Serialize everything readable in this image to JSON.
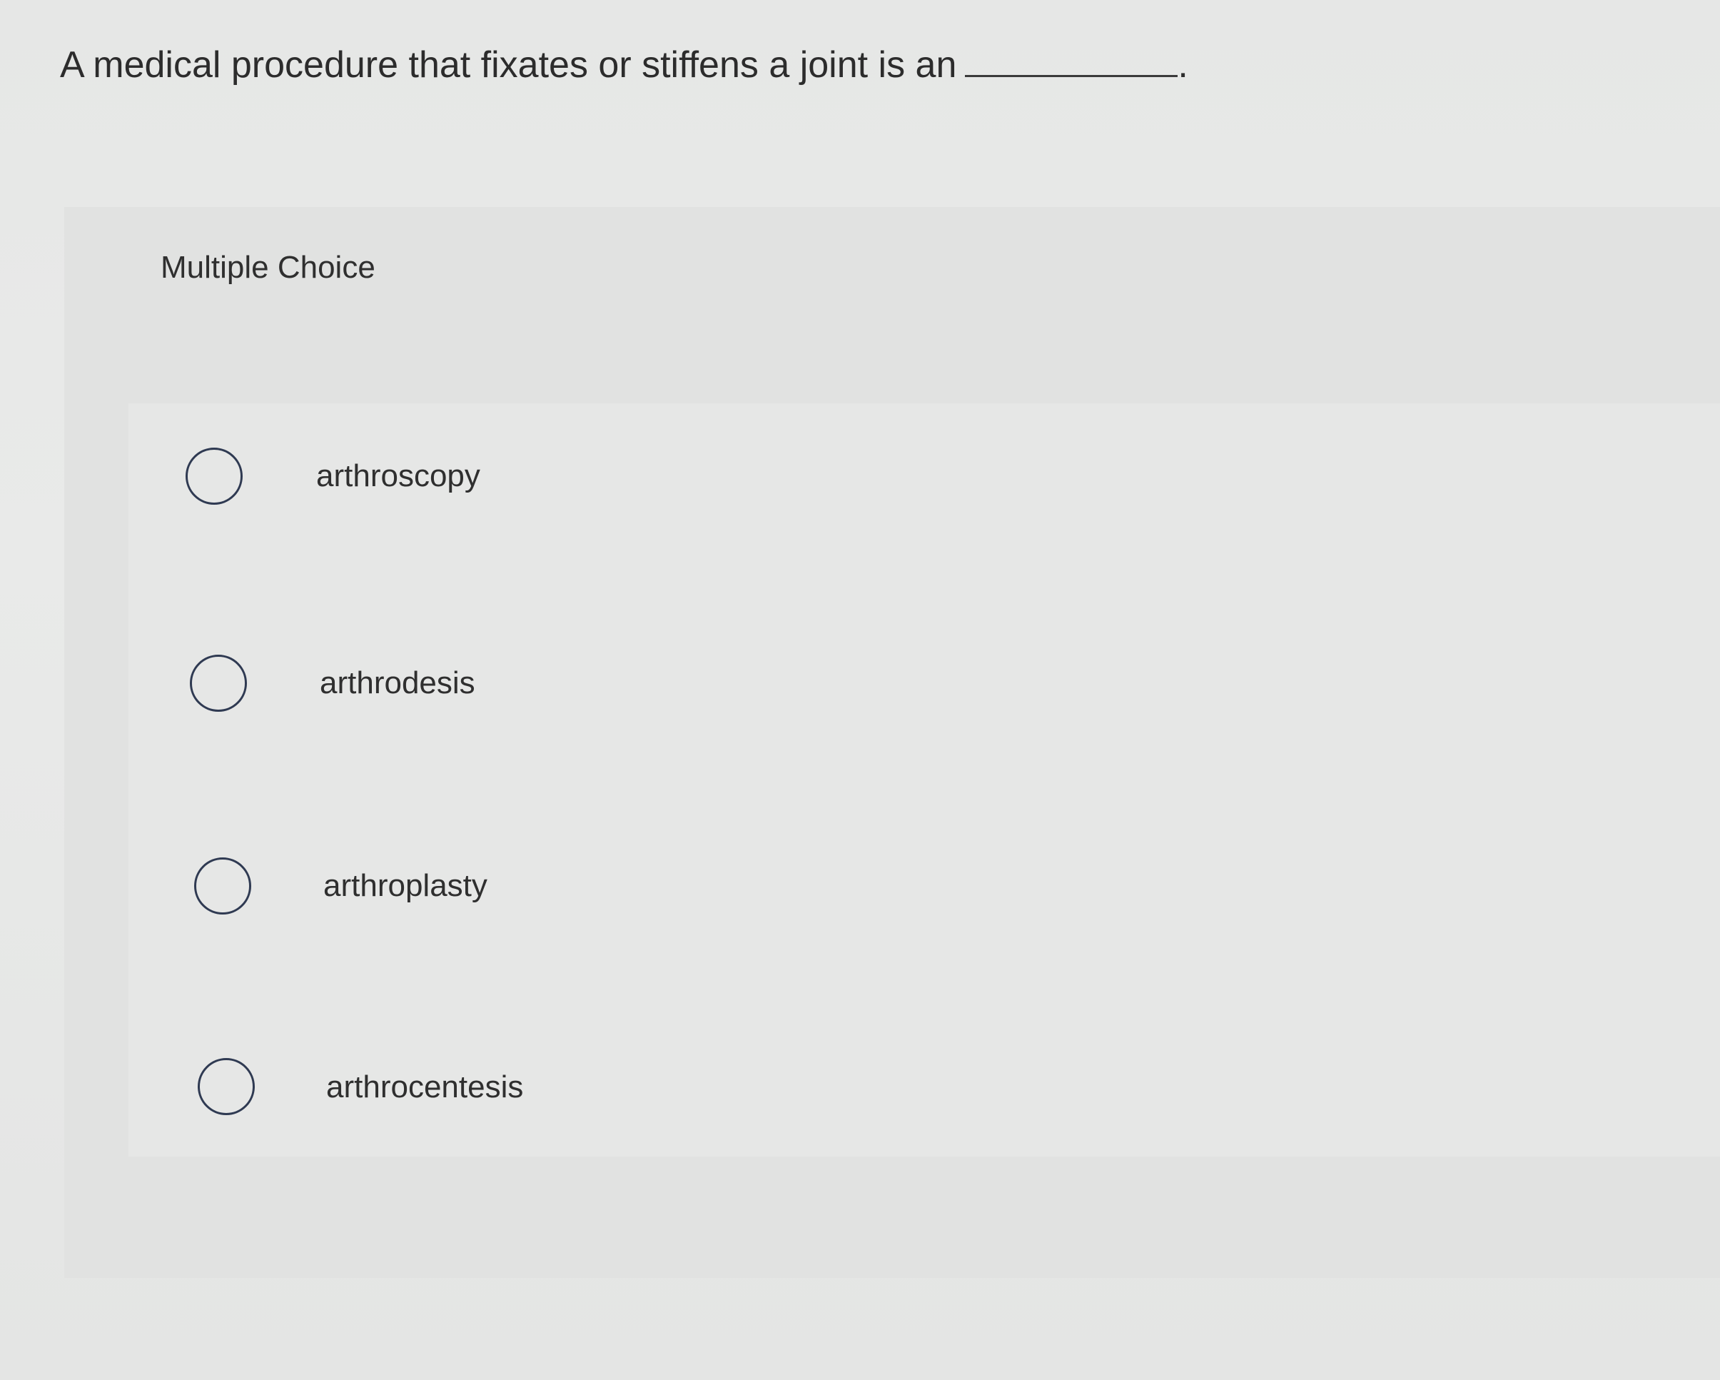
{
  "question": {
    "text": "A medical procedure that fixates or stiffens a joint is an",
    "trailing_punctuation": "."
  },
  "panel": {
    "label": "Multiple Choice"
  },
  "options": [
    {
      "label": "arthroscopy",
      "selected": false
    },
    {
      "label": "arthrodesis",
      "selected": false
    },
    {
      "label": "arthroplasty",
      "selected": false
    },
    {
      "label": "arthrocentesis",
      "selected": false
    }
  ]
}
